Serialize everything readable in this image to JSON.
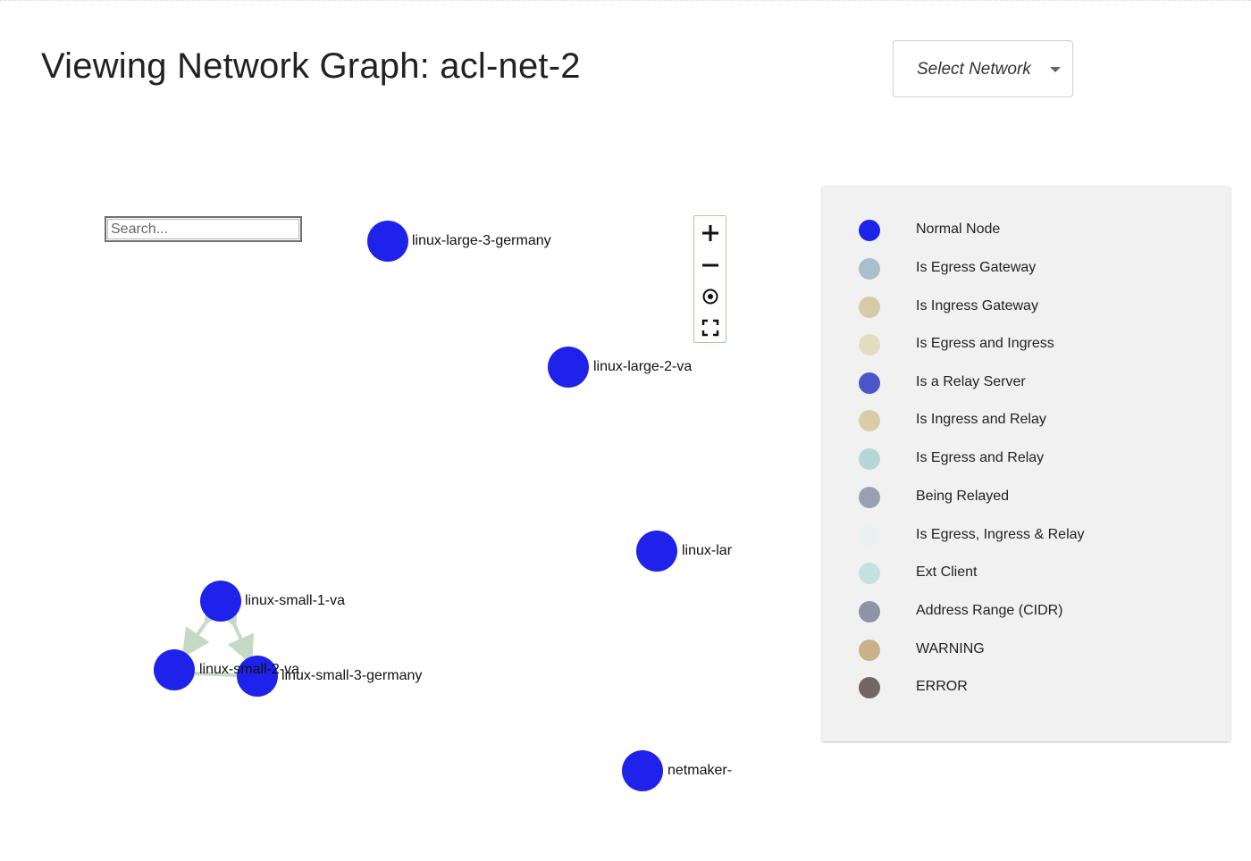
{
  "page": {
    "title": "Viewing Network Graph: acl-net-2"
  },
  "network_select": {
    "value": "Select Network"
  },
  "search": {
    "placeholder": "Search..."
  },
  "graph": {
    "nodes": [
      {
        "label": "linux-large-3-germany",
        "status": "Normal Node"
      },
      {
        "label": "linux-large-2-va",
        "status": "Normal Node"
      },
      {
        "label": "linux-lar",
        "status": "Normal Node"
      },
      {
        "label": "linux-small-1-va",
        "status": "Normal Node"
      },
      {
        "label": "linux-small-2-va",
        "status": "Normal Node"
      },
      {
        "label": "linux-small-3-germany",
        "status": "Normal Node"
      },
      {
        "label": "netmaker-",
        "status": "Normal Node"
      }
    ],
    "edges": [
      {
        "from": "linux-small-1-va",
        "to": "linux-small-2-va"
      },
      {
        "from": "linux-small-1-va",
        "to": "linux-small-3-germany"
      },
      {
        "from": "linux-small-2-va",
        "to": "linux-small-3-germany"
      }
    ],
    "node_color": "#1e22ea",
    "edge_color": "#c6d9c6"
  },
  "zoom_controls": {
    "zoom_in": "zoom-in-icon",
    "zoom_out": "zoom-out-icon",
    "center": "center-focus-icon",
    "fullscreen": "fullscreen-icon"
  },
  "legend": {
    "items": [
      {
        "label": "Normal Node",
        "color": "#1e22ea"
      },
      {
        "label": "Is Egress Gateway",
        "color": "#a9bfcc"
      },
      {
        "label": "Is Ingress Gateway",
        "color": "#d6cba6"
      },
      {
        "label": "Is Egress and Ingress",
        "color": "#e4dcc0"
      },
      {
        "label": "Is a Relay Server",
        "color": "#4a56c6"
      },
      {
        "label": "Is Ingress and Relay",
        "color": "#d8cda6"
      },
      {
        "label": "Is Egress and Relay",
        "color": "#b6d6da"
      },
      {
        "label": "Being Relayed",
        "color": "#9aa0b4"
      },
      {
        "label": "Is Egress, Ingress & Relay",
        "color": "#eaf1f1"
      },
      {
        "label": "Ext Client",
        "color": "#c4e0e0"
      },
      {
        "label": "Address Range (CIDR)",
        "color": "#8f93a8"
      },
      {
        "label": "WARNING",
        "color": "#c9b28a"
      },
      {
        "label": "ERROR",
        "color": "#746662"
      }
    ]
  }
}
